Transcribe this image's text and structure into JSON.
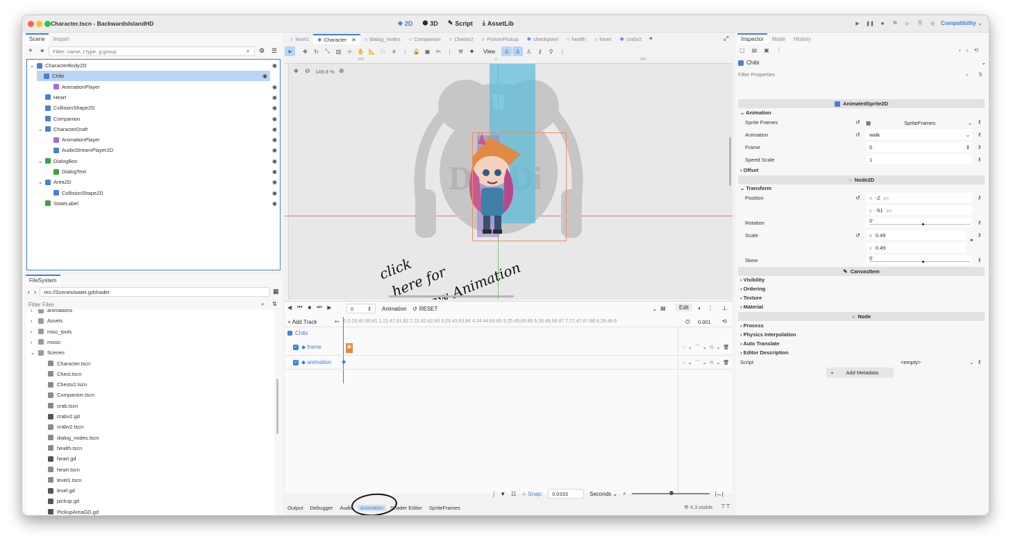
{
  "window": {
    "title": "Character.tscn - BackwardsIslandHD"
  },
  "modes": [
    {
      "label": "2D",
      "icon": "2d-view-icon"
    },
    {
      "label": "3D",
      "icon": "3d-view-icon"
    },
    {
      "label": "Script",
      "icon": "script-icon"
    },
    {
      "label": "AssetLib",
      "icon": "assetlib-icon"
    }
  ],
  "renderer": "Compatibility",
  "scene_dock": {
    "tabs": [
      "Scene",
      "Import"
    ],
    "filter_placeholder": "Filter: name, t:type, g:group",
    "nodes": [
      {
        "label": "CharacterBody2D",
        "color": "#4b7fd6"
      },
      {
        "label": "Chibi",
        "color": "#4b7fd6"
      },
      {
        "label": "AnimationPlayer",
        "color": "#a66cd9"
      },
      {
        "label": "Heart",
        "color": "#4b7fd6"
      },
      {
        "label": "CollisionShape2D",
        "color": "#4b7fd6"
      },
      {
        "label": "Companion",
        "color": "#4b7fd6"
      },
      {
        "label": "CharacterDraft",
        "color": "#4b7fd6"
      },
      {
        "label": "AnimationPlayer",
        "color": "#a66cd9"
      },
      {
        "label": "AudioStreamPlayer2D",
        "color": "#4b7fd6"
      },
      {
        "label": "DialogBox",
        "color": "#3da043"
      },
      {
        "label": "DialogText",
        "color": "#3da043"
      },
      {
        "label": "Area2D",
        "color": "#4b7fd6"
      },
      {
        "label": "CollisionShape2D",
        "color": "#4b7fd6"
      },
      {
        "label": "StateLabel",
        "color": "#3da043"
      }
    ]
  },
  "filesystem": {
    "tab": "FileSystem",
    "path": "res://Scenes/water.gdshader",
    "filter_placeholder": "Filter Files",
    "items": [
      "animations",
      "Assets",
      "misc_tools",
      "music",
      "Scenes",
      "Character.tscn",
      "Chest.tscn",
      "Chestv2.tscn",
      "Companion.tscn",
      "crab.tscn",
      "crabv2.gd",
      "crabv2.tscn",
      "dialog_nodes.tscn",
      "health.tscn",
      "heart.gd",
      "heart.tscn",
      "level1.tscn",
      "level.gd",
      "pickup.gd",
      "PickupAreaGD.gd"
    ]
  },
  "editor_tabs": [
    "level1",
    "Character",
    "dialog_nodes",
    "Companion",
    "Chestv2",
    "PoisonPickup",
    "checkpoint",
    "health",
    "heart",
    "crabv2"
  ],
  "toolbar": {
    "view_label": "View"
  },
  "viewport": {
    "zoom": "149.8 %",
    "ruler_left": "-250",
    "ruler_mid": "0",
    "ruler_right": "250"
  },
  "annotation": {
    "line1": "click",
    "line2": "here for",
    "line3": "new Animation"
  },
  "animation": {
    "time": "0",
    "anim_label": "Animation",
    "reset_label": "RESET",
    "edit_label": "Edit",
    "add_track": "Add Track",
    "ticks": "0 0.20.40.60.81 1.21.41.61.82 2.22.42.62.83 3.23.43.63.84 4.24.44.64.85 5.25.45.65.86 6.26.46.66.87 7.27.47.67.88 8.28.48.6",
    "length": "0.001",
    "root_node": "Chibi",
    "tracks": [
      {
        "name": "frame"
      },
      {
        "name": "animation"
      }
    ],
    "snap_label": "Snap:",
    "snap_value": "0.0333",
    "snap_unit": "Seconds"
  },
  "bottom_tabs": [
    "Output",
    "Debugger",
    "Audio",
    "Animation",
    "Shader Editor",
    "SpriteFrames"
  ],
  "version": "4.3.stable",
  "inspector": {
    "tabs": [
      "Inspector",
      "Node",
      "History"
    ],
    "node": "Chibi",
    "filter_placeholder": "Filter Properties",
    "class_title": "AnimatedSprite2D",
    "anim_section": "Animation",
    "sprite_frames_label": "Sprite Frames",
    "sprite_frames_value": "SpriteFrames",
    "animation_label": "Animation",
    "animation_value": "walk",
    "frame_label": "Frame",
    "frame_value": "0",
    "speed_label": "Speed Scale",
    "speed_value": "1",
    "offset": "Offset",
    "node2d": "Node2D",
    "transform": "Transform",
    "position_label": "Position",
    "pos_x": "-2",
    "pos_y": "-51",
    "px": "px",
    "rotation_label": "Rotation",
    "rotation_value": "0",
    "deg": "°",
    "scale_label": "Scale",
    "scale_x": "0.49",
    "scale_y": "0.49",
    "skew_label": "Skew",
    "skew_value": "0",
    "canvasitem": "CanvasItem",
    "ci_groups": [
      "Visibility",
      "Ordering",
      "Texture",
      "Material"
    ],
    "node_section": "Node",
    "node_groups": [
      "Process",
      "Physics Interpolation",
      "Auto Translate",
      "Editor Description"
    ],
    "script_label": "Script",
    "script_value": "<empty>",
    "add_metadata": "Add Metadata"
  }
}
